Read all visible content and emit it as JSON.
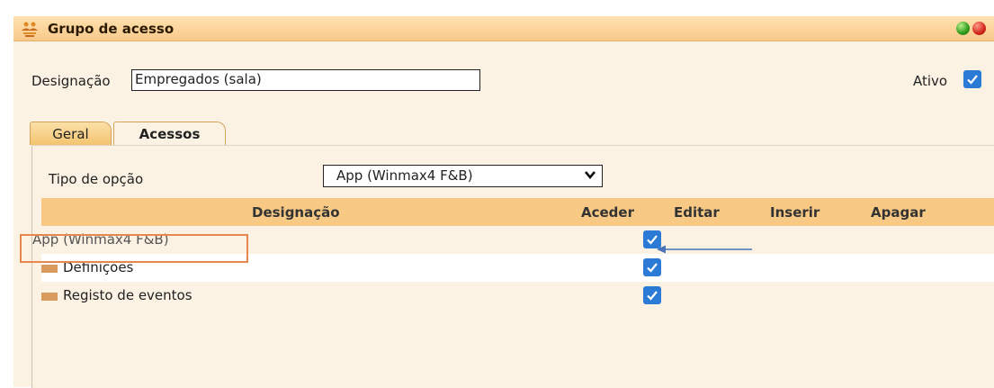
{
  "window": {
    "title": "Grupo de acesso"
  },
  "form": {
    "designacao_label": "Designação",
    "designacao_value": "Empregados (sala)",
    "ativo_label": "Ativo",
    "ativo_checked": true
  },
  "tabs": [
    {
      "label": "Geral",
      "active": true
    },
    {
      "label": "Acessos",
      "active": false
    }
  ],
  "tipo": {
    "label": "Tipo de opção",
    "value": "App (Winmax4 F&B)"
  },
  "grid": {
    "columns": [
      "Designação",
      "Aceder",
      "Editar",
      "Inserir",
      "Apagar"
    ],
    "rows": [
      {
        "label": "App (Winmax4 F&B)",
        "aceder": true,
        "folder": false
      },
      {
        "label": "Definições",
        "aceder": true,
        "folder": true
      },
      {
        "label": "Registo de eventos",
        "aceder": true,
        "folder": true
      }
    ]
  },
  "colors": {
    "accent_orange": "#f7c985",
    "checkbox_blue": "#2a7ad6",
    "highlight_orange": "#e8874d",
    "arrow_blue": "#4a73b8"
  },
  "icons": {
    "title": "group-icon",
    "window_green": "green-button-icon",
    "window_red": "red-button-icon",
    "select_arrow": "chevron-down-icon",
    "folder": "folder-icon",
    "check": "checkmark-icon"
  }
}
